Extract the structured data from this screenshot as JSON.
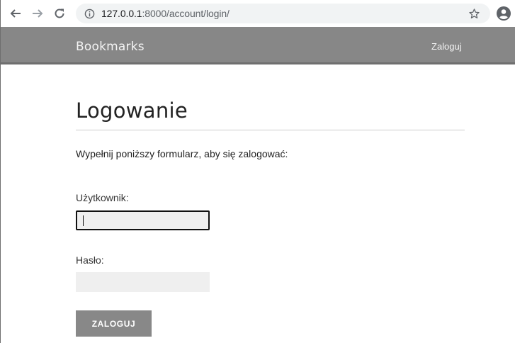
{
  "browser": {
    "url_host": "127.0.0.1",
    "url_rest": ":8000/account/login/"
  },
  "header": {
    "logo": "Bookmarks",
    "login_link": "Zaloguj"
  },
  "main": {
    "title": "Logowanie",
    "intro": "Wypełnij poniższy formularz, aby się zalogować:",
    "username_label": "Użytkownik:",
    "username_value": "",
    "password_label": "Hasło:",
    "password_value": "",
    "submit_label": "ZALOGUJ"
  },
  "icons": {
    "back": "back-arrow-icon",
    "forward": "forward-arrow-icon",
    "reload": "reload-icon",
    "info": "info-icon",
    "star": "star-icon",
    "account": "account-icon"
  },
  "colors": {
    "header_bg": "#878787",
    "input_bg": "#efefef",
    "button_bg": "#888888"
  }
}
